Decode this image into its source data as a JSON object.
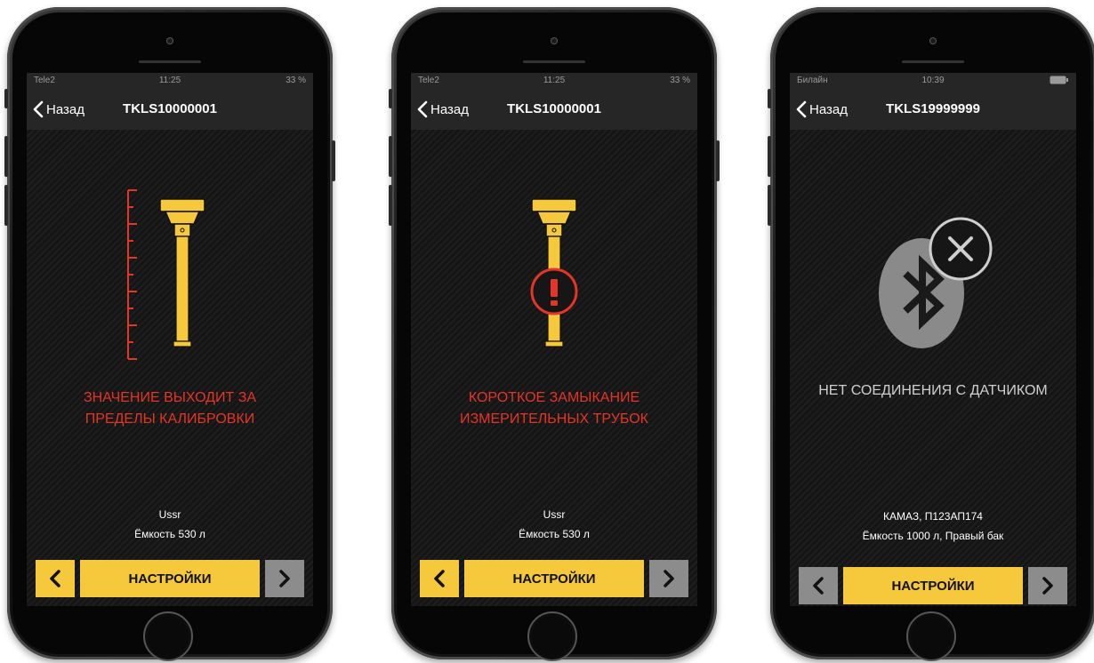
{
  "accent_color": "#f6c83c",
  "error_color": "#e53526",
  "phones": [
    {
      "status": {
        "carrier": "Tele2",
        "time": "11:25",
        "battery": "33 %"
      },
      "back_label": "Назад",
      "title": "TKLS10000001",
      "illustration_icon": "sensor-out-of-range-icon",
      "message_lines": [
        "ЗНАЧЕНИЕ ВЫХОДИТ ЗА",
        "ПРЕДЕЛЫ КАЛИБРОВКИ"
      ],
      "message_color": "#e53526",
      "info_lines": [
        "Ussr",
        "Ёмкость 530 л"
      ],
      "settings_label": "НАСТРОЙКИ",
      "prev_active": true,
      "next_active": false
    },
    {
      "status": {
        "carrier": "Tele2",
        "time": "11:25",
        "battery": "33 %"
      },
      "back_label": "Назад",
      "title": "TKLS10000001",
      "illustration_icon": "sensor-short-circuit-icon",
      "message_lines": [
        "КОРОТКОЕ ЗАМЫКАНИЕ",
        "ИЗМЕРИТЕЛЬНЫХ ТРУБОК"
      ],
      "message_color": "#e53526",
      "info_lines": [
        "Ussr",
        "Ёмкость 530 л"
      ],
      "settings_label": "НАСТРОЙКИ",
      "prev_active": true,
      "next_active": false
    },
    {
      "status": {
        "carrier": "Билайн",
        "time": "10:39",
        "battery": ""
      },
      "back_label": "Назад",
      "title": "TKLS19999999",
      "illustration_icon": "bluetooth-disconnected-icon",
      "message_lines": [
        "НЕТ СОЕДИНЕНИЯ С ДАТЧИКОМ"
      ],
      "message_color": "#cfcfcf",
      "info_lines": [
        "КАМАЗ, П123АП174",
        "Ёмкость 1000 л, Правый бак"
      ],
      "settings_label": "НАСТРОЙКИ",
      "prev_active": false,
      "next_active": false
    }
  ]
}
